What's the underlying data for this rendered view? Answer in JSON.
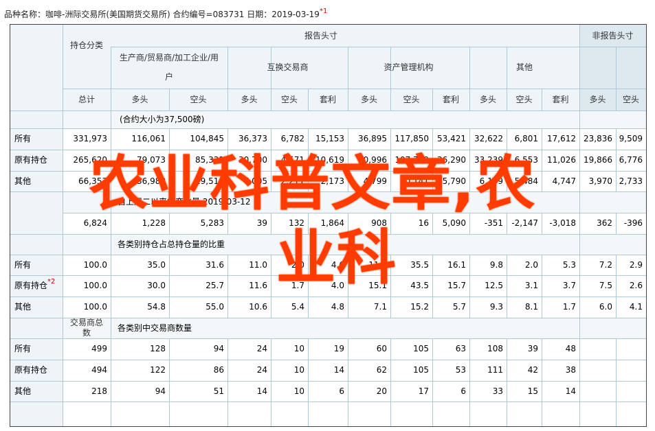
{
  "caption": {
    "text": "品种名称：咖啡-洲际交易所(美国期货交易所)   合约编号=083731   日期：2019-03-19",
    "note_mark": "*1"
  },
  "header": {
    "report_head": "报告头寸",
    "non_report_head": "非报告头寸",
    "position_class": "持仓分类",
    "groups": [
      "生产商/贸易商/加工企业/用户",
      "互换交易商",
      "资产管理机构",
      "其他"
    ],
    "total": "总计",
    "sub": [
      "多头",
      "空头",
      "多头",
      "空头",
      "套利",
      "多头",
      "空头",
      "套利",
      "多头",
      "空头",
      "套利",
      "多头",
      "空头"
    ]
  },
  "sections": [
    {
      "title": "(合约大小为37,500磅)",
      "rows": [
        {
          "label": "所有",
          "note": "",
          "values": [
            "331,973",
            "116,061",
            "104,845",
            "36,373",
            "6,782",
            "15,153",
            "36,895",
            "117,850",
            "53,421",
            "32,622",
            "6,801",
            "17,612",
            "23,836",
            "9,509"
          ]
        },
        {
          "label": "原有持仓",
          "note": "",
          "values": [
            "265,620",
            "79,073",
            "85,331",
            "30,700",
            "4,571",
            "10,619",
            "30,996",
            "107,709",
            "36,290",
            "33,239",
            "6,553",
            "11,026",
            "19,866",
            "6,776"
          ]
        },
        {
          "label": "其他",
          "note": "",
          "values": [
            "66,353",
            "36,988",
            "19,514",
            "7,005",
            "2,211",
            "2,173",
            "4,799",
            "10,141",
            "15,790",
            "6,159",
            "5,484",
            "4,747",
            "3,970",
            "2,733"
          ]
        }
      ]
    },
    {
      "title": "自上周二以来的变化量 2019-03-12",
      "rows": [
        {
          "label": "",
          "note": "",
          "values": [
            "6,824",
            "1,228",
            "5,283",
            "39",
            "132",
            "1,864",
            "908",
            "16",
            "5,090",
            "-351",
            "-2,147",
            "-3,018",
            "362",
            "-396"
          ]
        }
      ]
    },
    {
      "title": "各类别持仓占总持仓量的比重",
      "rows": [
        {
          "label": "所有",
          "note": "",
          "values": [
            "100.0",
            "35.0",
            "31.6",
            "11.0",
            "2.0",
            "4.6",
            "11.1",
            "35.5",
            "16.1",
            "9.8",
            "2.0",
            "5.3",
            "7.2",
            "2.9"
          ]
        },
        {
          "label": "原有持仓",
          "note": "*2",
          "values": [
            "100.0",
            "30.0",
            "25.7",
            "11.6",
            "1.7",
            "4.0",
            "15.1",
            "43.5",
            "15.7",
            "12.5",
            "3.1",
            "3.7",
            "7.5",
            "2.6"
          ]
        },
        {
          "label": "其他",
          "note": "",
          "values": [
            "100.0",
            "54.8",
            "55.0",
            "10.6",
            "5.4",
            "4.8",
            "7.1",
            "15.2",
            "5.7",
            "9.3",
            "8.1",
            "1.7",
            "6.0",
            "4.1"
          ]
        }
      ]
    },
    {
      "title": "各类别中交易商数量",
      "left_header": [
        "交易商总",
        "数"
      ],
      "rows": [
        {
          "label": "所有",
          "note": "",
          "values": [
            "499",
            "128",
            "94",
            "24",
            "10",
            "19",
            "60",
            "105",
            "63",
            "108",
            "39",
            "48",
            "",
            ""
          ]
        },
        {
          "label": "原有持仓",
          "note": "",
          "values": [
            "494",
            "122",
            "86",
            "24",
            "10",
            "14",
            "62",
            "105",
            "53",
            "111",
            "42",
            "38",
            "",
            ""
          ]
        },
        {
          "label": "其他",
          "note": "",
          "values": [
            "218",
            "94",
            "51",
            "14",
            "10",
            "6",
            "20",
            "17",
            "6",
            "33",
            "15",
            "14",
            "",
            ""
          ]
        }
      ]
    }
  ],
  "watermark": {
    "line1": "农业科普文章,农",
    "line2": "业科",
    "color": "#ff3c00"
  },
  "colors": {
    "grid": "#aec9d5",
    "header_bg": "#eef4f8",
    "non_report_bg": "#dde8ef",
    "section_bg": "#f3f7fa",
    "border": "#444444"
  }
}
